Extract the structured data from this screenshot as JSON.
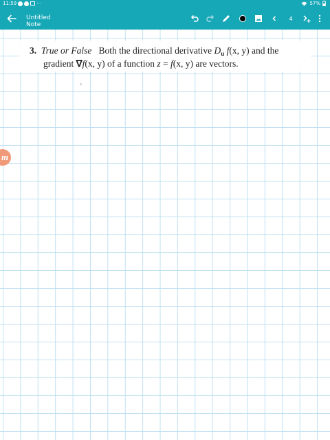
{
  "status_bar": {
    "time": "11:59",
    "more": "···",
    "battery": "57%",
    "icons": [
      "notification-icon",
      "notification-icon",
      "image-icon",
      "wifi-icon",
      "battery-icon"
    ]
  },
  "toolbar": {
    "title": "Untitled Note",
    "page_number": "4",
    "pen_color": "#000000",
    "icons": [
      "back-arrow-icon",
      "undo-icon",
      "redo-icon",
      "pen-icon",
      "color-dot-icon",
      "image-icon",
      "chevron-left-icon",
      "add-page-icon",
      "more-vertical-icon"
    ]
  },
  "colors": {
    "accent": "#17a8b8",
    "grid_line": "#bfe0f2",
    "badge": "#f09a7a"
  },
  "problem": {
    "number": "3.",
    "lead": "True or False",
    "line1_a": "Both the directional derivative ",
    "deriv_D": "D",
    "deriv_sub": "u",
    "func_1": "f",
    "args_1": "(x, y)",
    "line1_b": " and the",
    "line2_a": "gradient ",
    "nabla": "∇",
    "func_2": "f",
    "args_2": "(x, y)",
    "line2_b": " of a function ",
    "z": "z",
    "eq": " = ",
    "func_3": "f",
    "args_3": "(x, y)",
    "line2_c": " are vectors."
  },
  "side_badge": {
    "letter": "m"
  }
}
